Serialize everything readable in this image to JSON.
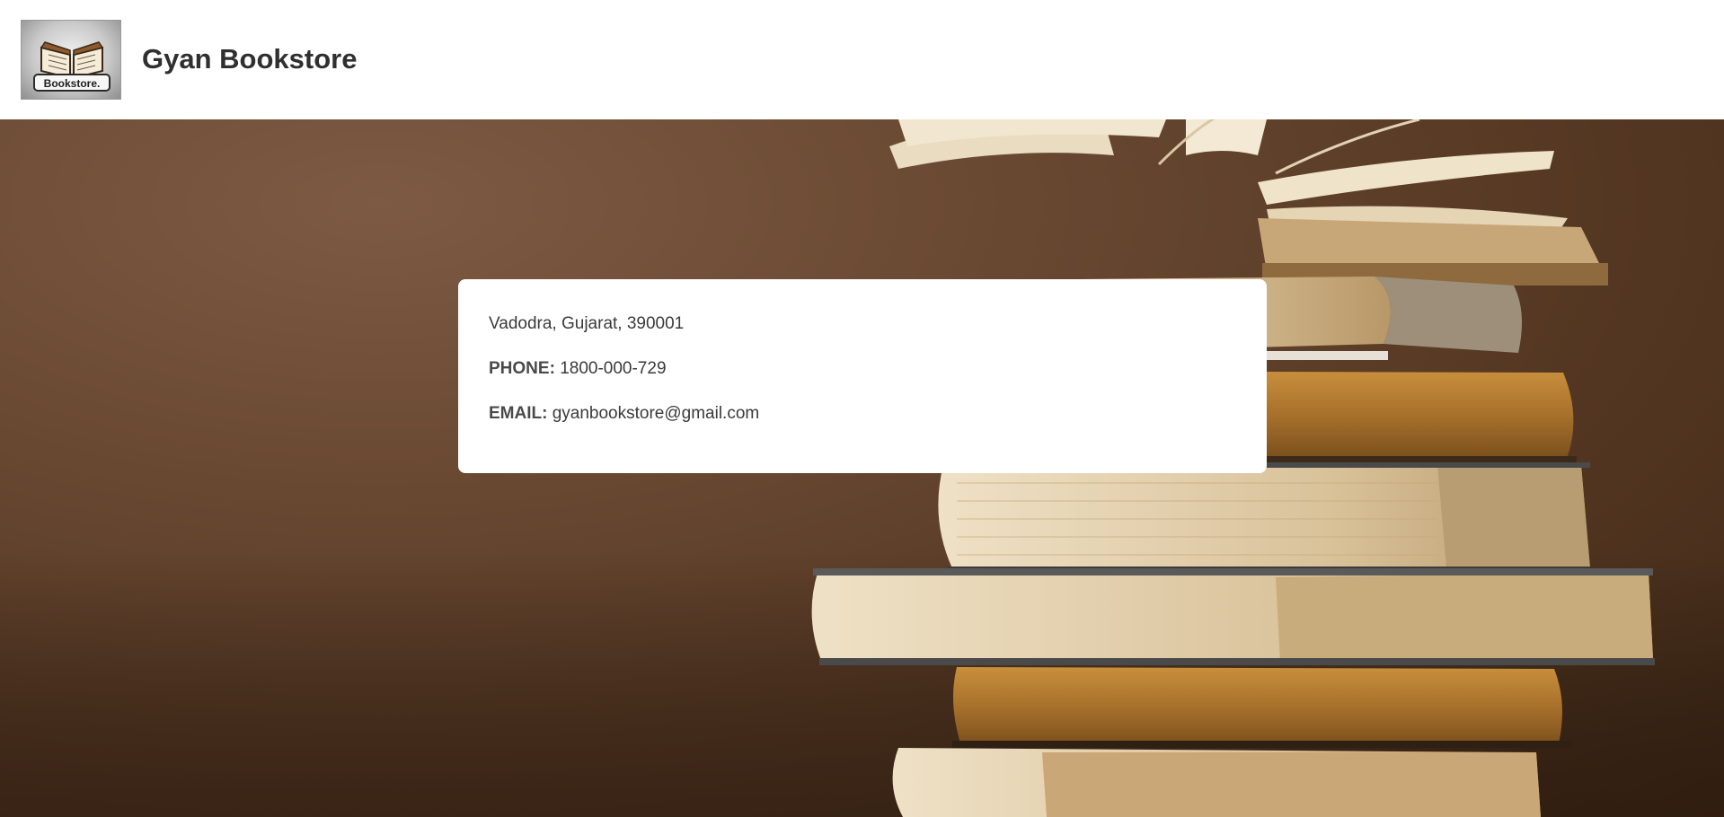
{
  "header": {
    "logo_text": "Bookstore.",
    "title": "Gyan Bookstore"
  },
  "contact": {
    "address": "Vadodra, Gujarat, 390001",
    "phone_label": "PHONE:",
    "phone_value": "1800-000-729",
    "email_label": "EMAIL:",
    "email_value": "gyanbookstore@gmail.com"
  },
  "hero": {
    "image": "stack-of-books-photo"
  }
}
